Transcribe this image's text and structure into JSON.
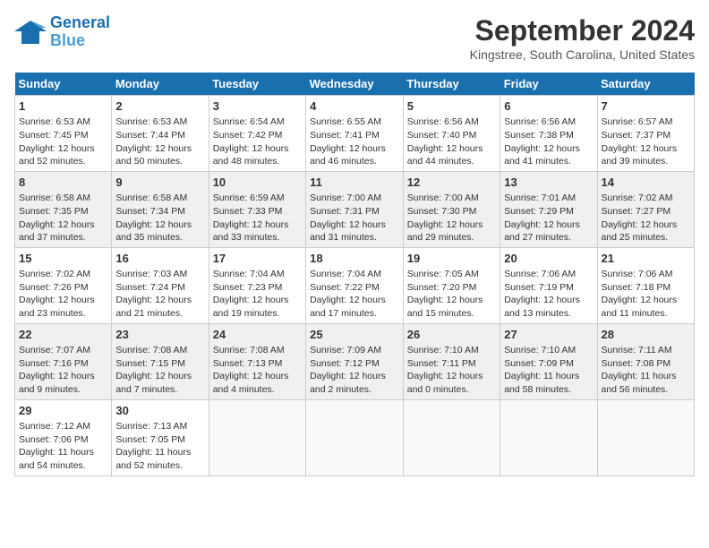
{
  "logo": {
    "line1": "General",
    "line2": "Blue"
  },
  "title": "September 2024",
  "location": "Kingstree, South Carolina, United States",
  "days_of_week": [
    "Sunday",
    "Monday",
    "Tuesday",
    "Wednesday",
    "Thursday",
    "Friday",
    "Saturday"
  ],
  "weeks": [
    [
      {
        "day": "1",
        "sunrise": "6:53 AM",
        "sunset": "7:45 PM",
        "daylight": "12 hours and 52 minutes."
      },
      {
        "day": "2",
        "sunrise": "6:53 AM",
        "sunset": "7:44 PM",
        "daylight": "12 hours and 50 minutes."
      },
      {
        "day": "3",
        "sunrise": "6:54 AM",
        "sunset": "7:42 PM",
        "daylight": "12 hours and 48 minutes."
      },
      {
        "day": "4",
        "sunrise": "6:55 AM",
        "sunset": "7:41 PM",
        "daylight": "12 hours and 46 minutes."
      },
      {
        "day": "5",
        "sunrise": "6:56 AM",
        "sunset": "7:40 PM",
        "daylight": "12 hours and 44 minutes."
      },
      {
        "day": "6",
        "sunrise": "6:56 AM",
        "sunset": "7:38 PM",
        "daylight": "12 hours and 41 minutes."
      },
      {
        "day": "7",
        "sunrise": "6:57 AM",
        "sunset": "7:37 PM",
        "daylight": "12 hours and 39 minutes."
      }
    ],
    [
      {
        "day": "8",
        "sunrise": "6:58 AM",
        "sunset": "7:35 PM",
        "daylight": "12 hours and 37 minutes."
      },
      {
        "day": "9",
        "sunrise": "6:58 AM",
        "sunset": "7:34 PM",
        "daylight": "12 hours and 35 minutes."
      },
      {
        "day": "10",
        "sunrise": "6:59 AM",
        "sunset": "7:33 PM",
        "daylight": "12 hours and 33 minutes."
      },
      {
        "day": "11",
        "sunrise": "7:00 AM",
        "sunset": "7:31 PM",
        "daylight": "12 hours and 31 minutes."
      },
      {
        "day": "12",
        "sunrise": "7:00 AM",
        "sunset": "7:30 PM",
        "daylight": "12 hours and 29 minutes."
      },
      {
        "day": "13",
        "sunrise": "7:01 AM",
        "sunset": "7:29 PM",
        "daylight": "12 hours and 27 minutes."
      },
      {
        "day": "14",
        "sunrise": "7:02 AM",
        "sunset": "7:27 PM",
        "daylight": "12 hours and 25 minutes."
      }
    ],
    [
      {
        "day": "15",
        "sunrise": "7:02 AM",
        "sunset": "7:26 PM",
        "daylight": "12 hours and 23 minutes."
      },
      {
        "day": "16",
        "sunrise": "7:03 AM",
        "sunset": "7:24 PM",
        "daylight": "12 hours and 21 minutes."
      },
      {
        "day": "17",
        "sunrise": "7:04 AM",
        "sunset": "7:23 PM",
        "daylight": "12 hours and 19 minutes."
      },
      {
        "day": "18",
        "sunrise": "7:04 AM",
        "sunset": "7:22 PM",
        "daylight": "12 hours and 17 minutes."
      },
      {
        "day": "19",
        "sunrise": "7:05 AM",
        "sunset": "7:20 PM",
        "daylight": "12 hours and 15 minutes."
      },
      {
        "day": "20",
        "sunrise": "7:06 AM",
        "sunset": "7:19 PM",
        "daylight": "12 hours and 13 minutes."
      },
      {
        "day": "21",
        "sunrise": "7:06 AM",
        "sunset": "7:18 PM",
        "daylight": "12 hours and 11 minutes."
      }
    ],
    [
      {
        "day": "22",
        "sunrise": "7:07 AM",
        "sunset": "7:16 PM",
        "daylight": "12 hours and 9 minutes."
      },
      {
        "day": "23",
        "sunrise": "7:08 AM",
        "sunset": "7:15 PM",
        "daylight": "12 hours and 7 minutes."
      },
      {
        "day": "24",
        "sunrise": "7:08 AM",
        "sunset": "7:13 PM",
        "daylight": "12 hours and 4 minutes."
      },
      {
        "day": "25",
        "sunrise": "7:09 AM",
        "sunset": "7:12 PM",
        "daylight": "12 hours and 2 minutes."
      },
      {
        "day": "26",
        "sunrise": "7:10 AM",
        "sunset": "7:11 PM",
        "daylight": "12 hours and 0 minutes."
      },
      {
        "day": "27",
        "sunrise": "7:10 AM",
        "sunset": "7:09 PM",
        "daylight": "11 hours and 58 minutes."
      },
      {
        "day": "28",
        "sunrise": "7:11 AM",
        "sunset": "7:08 PM",
        "daylight": "11 hours and 56 minutes."
      }
    ],
    [
      {
        "day": "29",
        "sunrise": "7:12 AM",
        "sunset": "7:06 PM",
        "daylight": "11 hours and 54 minutes."
      },
      {
        "day": "30",
        "sunrise": "7:13 AM",
        "sunset": "7:05 PM",
        "daylight": "11 hours and 52 minutes."
      },
      null,
      null,
      null,
      null,
      null
    ]
  ]
}
